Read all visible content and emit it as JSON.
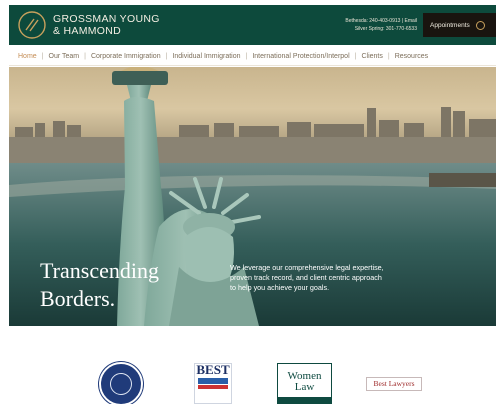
{
  "header": {
    "firm_name_line1": "GROSSMAN YOUNG",
    "firm_name_line2": "& HAMMOND",
    "contact_line1": "Bethesda: 240-403-0913  |  Email",
    "contact_line2": "Silver Spring: 301-770-6533",
    "appointment_label": "Appointments",
    "logo_icon": "gyh-monogram-icon",
    "colors": {
      "header_bg": "#0d4a3c",
      "accent": "#c58d55"
    }
  },
  "nav": {
    "items": [
      {
        "label": "Home",
        "active": true
      },
      {
        "label": "Our Team"
      },
      {
        "label": "Corporate Immigration"
      },
      {
        "label": "Individual Immigration"
      },
      {
        "label": "International Protection/Interpol"
      },
      {
        "label": "Clients"
      },
      {
        "label": "Resources"
      }
    ]
  },
  "hero": {
    "title_line1": "Transcending",
    "title_line2": "Borders.",
    "copy": "We leverage our comprehensive legal expertise, proven track record, and client centric approach to help you achieve your goals."
  },
  "badges": [
    {
      "name": "seal-badge"
    },
    {
      "name": "best-badge",
      "text_top": "",
      "text_big": "BEST"
    },
    {
      "name": "women-in-law-badge",
      "text": "Women Law"
    },
    {
      "name": "best-lawyers-badge",
      "text": "Best Lawyers"
    }
  ]
}
